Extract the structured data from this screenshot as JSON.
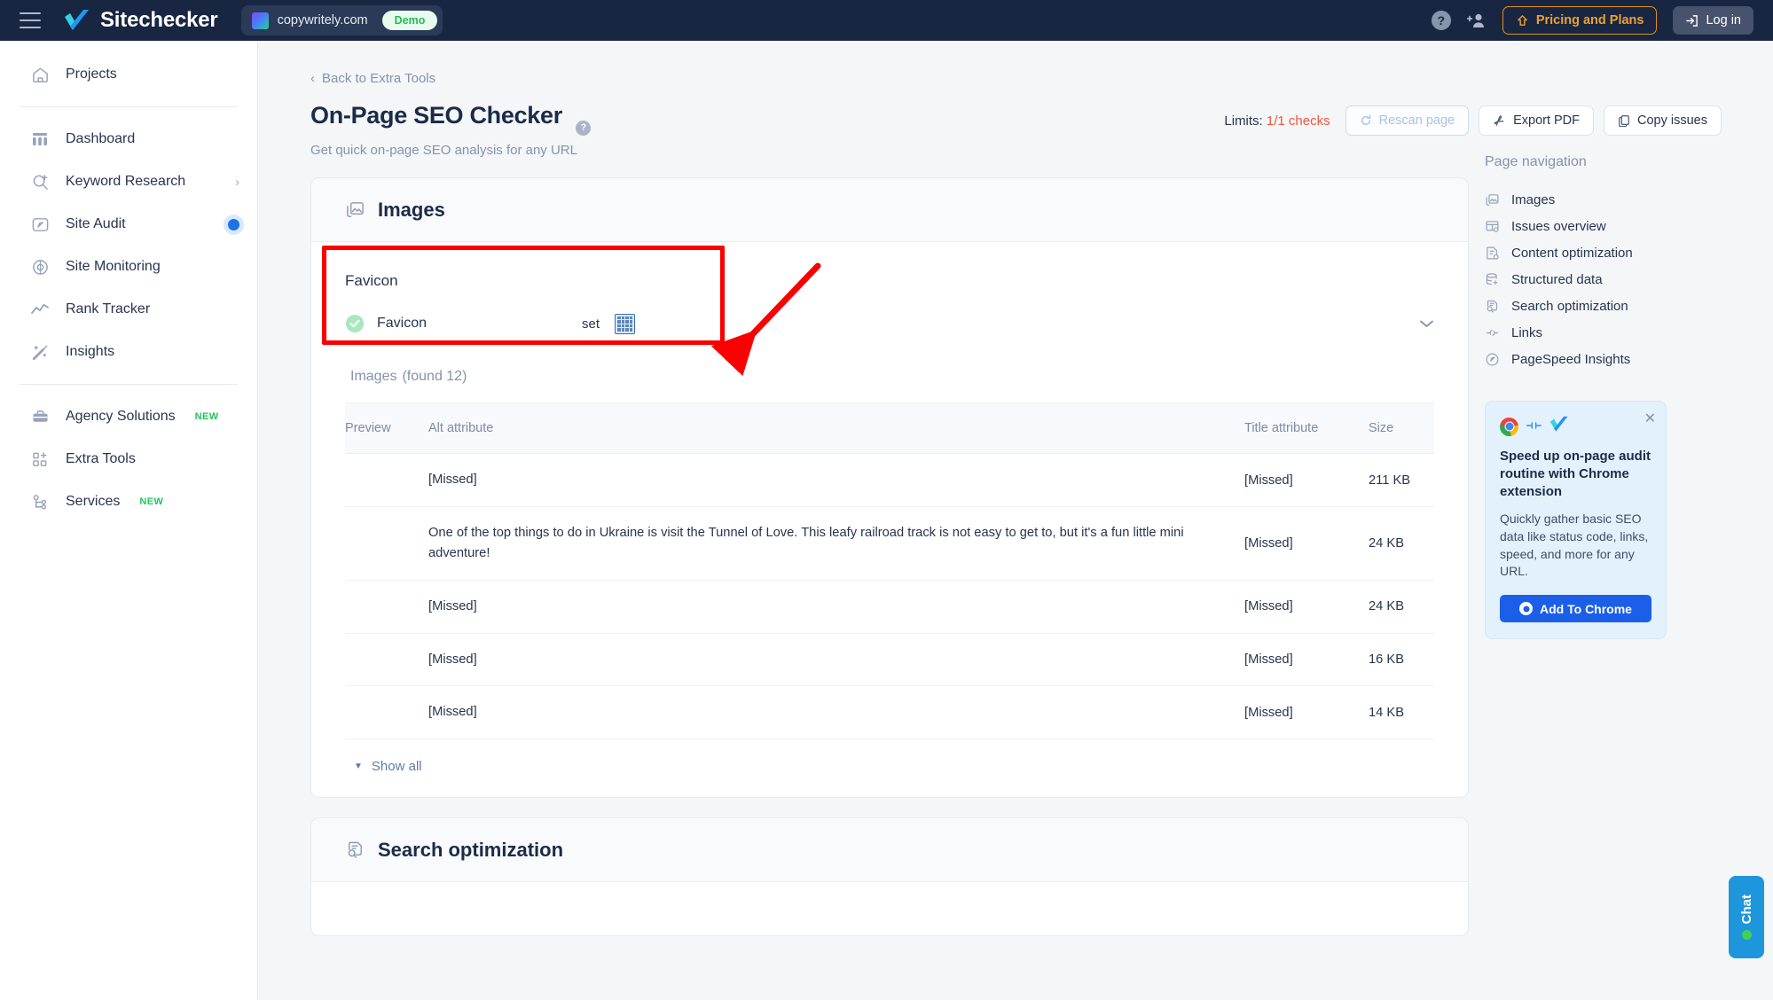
{
  "topbar": {
    "menu_icon": "hamburger-icon",
    "brand": "Sitechecker",
    "site_name": "copywritely.com",
    "demo_badge": "Demo",
    "help_icon": "question-mark-icon",
    "invite_icon": "add-user-icon",
    "pricing_label": "Pricing and Plans",
    "login_label": "Log in"
  },
  "sidebar": {
    "top": [
      {
        "label": "Projects",
        "icon": "home-icon"
      }
    ],
    "items": [
      {
        "label": "Dashboard",
        "icon": "dashboard-icon"
      },
      {
        "label": "Keyword Research",
        "icon": "keyword-search-icon",
        "chevron": "›"
      },
      {
        "label": "Site Audit",
        "icon": "gauge-icon",
        "active": true
      },
      {
        "label": "Site Monitoring",
        "icon": "target-icon"
      },
      {
        "label": "Rank Tracker",
        "icon": "line-chart-icon"
      },
      {
        "label": "Insights",
        "icon": "magic-wand-icon"
      }
    ],
    "bottom": [
      {
        "label": "Agency Solutions",
        "icon": "briefcase-icon",
        "tag": "NEW"
      },
      {
        "label": "Extra Tools",
        "icon": "grid-plus-icon",
        "tag": ""
      },
      {
        "label": "Services",
        "icon": "services-icon",
        "tag": "NEW"
      }
    ]
  },
  "page": {
    "breadcrumb": "Back to Extra Tools",
    "title": "On-Page SEO Checker",
    "subtitle": "Get quick on-page SEO analysis for any URL",
    "limits_label": "Limits:",
    "limits_value": "1/1 checks",
    "buttons": {
      "rescan": "Rescan page",
      "export": "Export PDF",
      "copy": "Copy issues"
    }
  },
  "images_section": {
    "heading": "Images",
    "favicon": {
      "card_title": "Favicon",
      "row_label": "Favicon",
      "status": "set",
      "status_icon": "green-check-icon",
      "thumb_icon": "favicon-thumbnail-icon",
      "chevron_icon": "chevron-down-icon"
    },
    "table_title": "Images",
    "table_count": "(found 12)",
    "columns": [
      "Preview",
      "Alt attribute",
      "Title attribute",
      "Size"
    ],
    "rows": [
      {
        "preview": "",
        "alt": "[Missed]",
        "alt_missed": true,
        "title": "[Missed]",
        "size": "211 KB"
      },
      {
        "preview": "",
        "alt": "One of the top things to do in Ukraine is visit the Tunnel of Love. This leafy railroad track is not easy to get to, but it's a fun little mini adventure!",
        "alt_missed": false,
        "title": "[Missed]",
        "size": "24 KB"
      },
      {
        "preview": "",
        "alt": "[Missed]",
        "alt_missed": true,
        "title": "[Missed]",
        "size": "24 KB"
      },
      {
        "preview": "",
        "alt": "[Missed]",
        "alt_missed": true,
        "title": "[Missed]",
        "size": "16 KB"
      },
      {
        "preview": "",
        "alt": "[Missed]",
        "alt_missed": true,
        "title": "[Missed]",
        "size": "14 KB"
      }
    ],
    "show_all": "Show all"
  },
  "search_section": {
    "heading": "Search optimization"
  },
  "page_nav": {
    "title": "Page navigation",
    "items": [
      {
        "label": "Images",
        "icon": "images-icon"
      },
      {
        "label": "Issues overview",
        "icon": "issues-icon"
      },
      {
        "label": "Content optimization",
        "icon": "content-icon"
      },
      {
        "label": "Structured data",
        "icon": "database-icon"
      },
      {
        "label": "Search optimization",
        "icon": "search-doc-icon"
      },
      {
        "label": "Links",
        "icon": "link-icon"
      },
      {
        "label": "PageSpeed Insights",
        "icon": "speed-gauge-icon"
      }
    ]
  },
  "promo": {
    "close_icon": "close-icon",
    "chrome_icon": "chrome-icon",
    "plug_icon": "plug-icon",
    "checkmark_icon": "sitechecker-logo-icon",
    "heading": "Speed up on-page audit routine with Chrome extension",
    "body": "Quickly gather basic SEO data like status code, links, speed, and more for any URL.",
    "button": "Add To Chrome"
  },
  "chat": {
    "label": "Chat",
    "status_icon": "online-dot-icon"
  },
  "colors": {
    "topbar_bg": "#182642",
    "accent_blue": "#1a73e8",
    "orange": "#f0a030",
    "red": "#f4543c",
    "green": "#22c55e",
    "annotation_red": "#fb0000"
  }
}
